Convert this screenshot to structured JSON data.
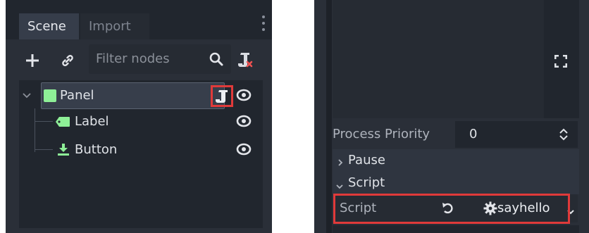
{
  "scene_dock": {
    "tabs": [
      {
        "label": "Scene",
        "active": true
      },
      {
        "label": "Import",
        "active": false
      }
    ],
    "toolbar": {
      "add_icon": "plus-icon",
      "link_icon": "link-icon",
      "filter_placeholder": "Filter nodes",
      "search_icon": "search-icon",
      "script_icon": "script-remove-icon"
    },
    "tree": [
      {
        "label": "Panel",
        "icon": "panel-icon",
        "icon_color": "#8eef97",
        "selected": true,
        "has_script": true
      },
      {
        "label": "Label",
        "icon": "label-icon",
        "icon_color": "#8eef97"
      },
      {
        "label": "Button",
        "icon": "button-icon",
        "icon_color": "#8eef97"
      }
    ]
  },
  "inspector": {
    "process_priority": {
      "label": "Process Priority",
      "value": "0"
    },
    "sections": [
      {
        "label": "Pause",
        "expanded": false
      },
      {
        "label": "Script",
        "expanded": true
      }
    ],
    "script_property": {
      "label": "Script",
      "value": "sayhello"
    }
  },
  "colors": {
    "highlight": "#e03a3a",
    "node_green": "#8eef97",
    "panel_bg": "#2a2f38"
  }
}
